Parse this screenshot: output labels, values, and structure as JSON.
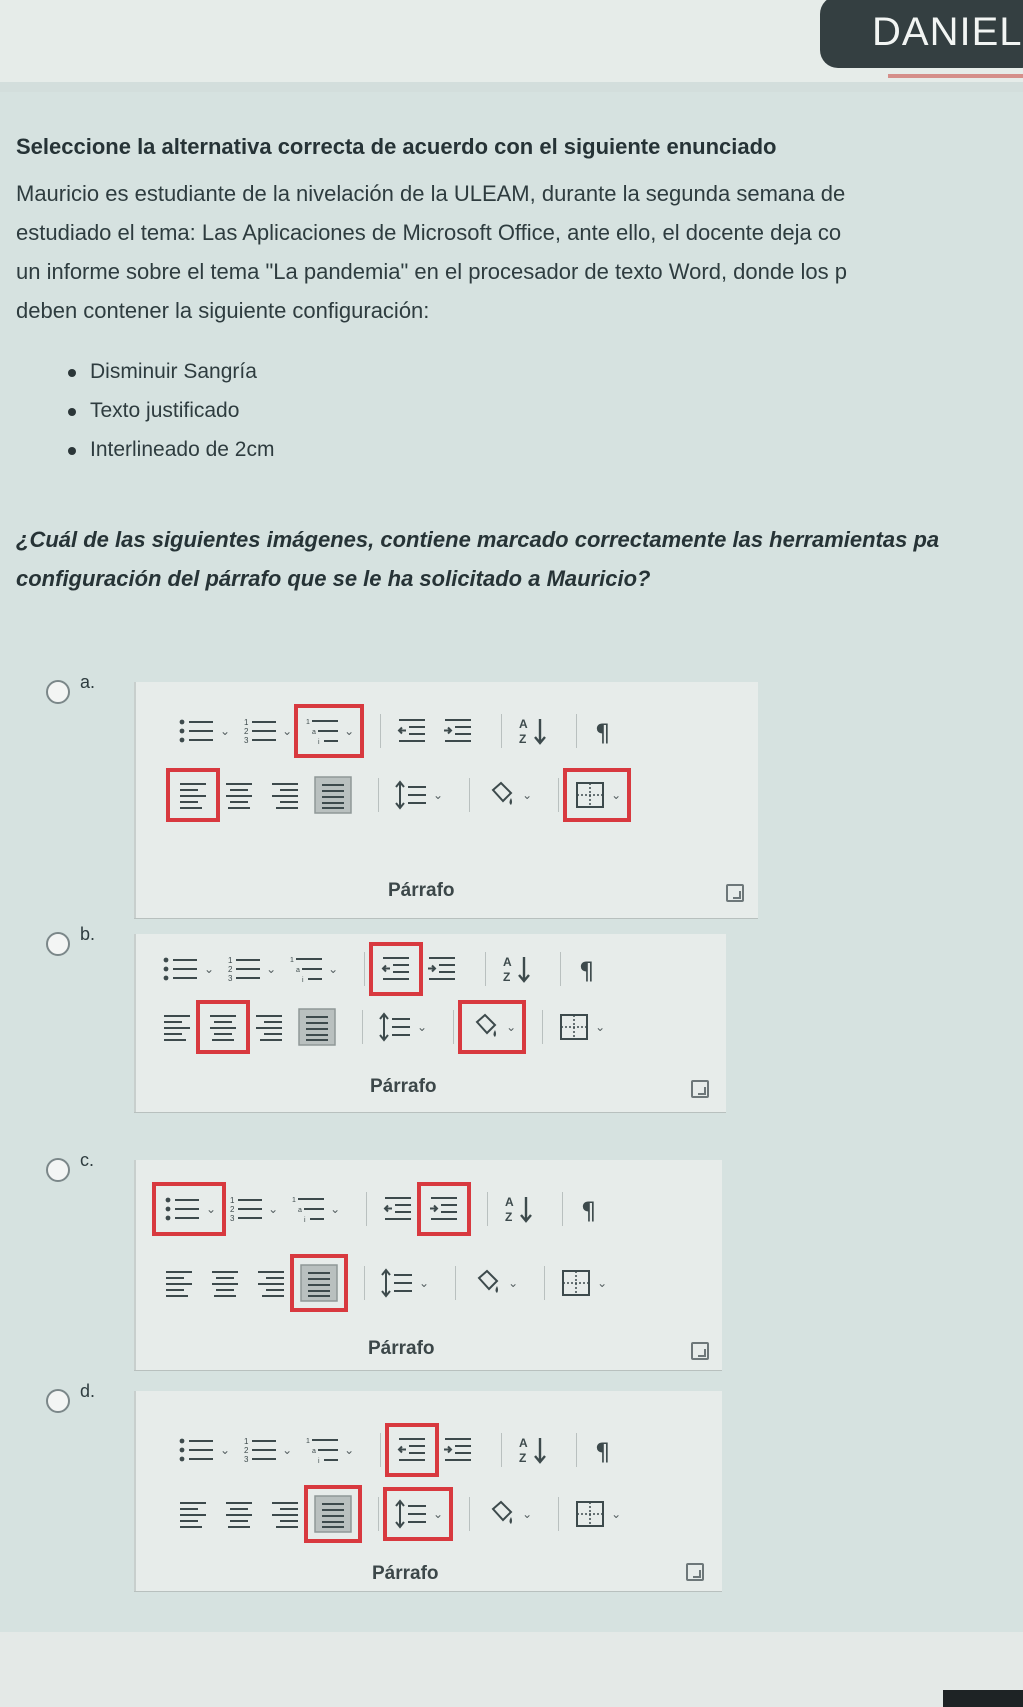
{
  "header": {
    "user_name": "DANIEL"
  },
  "heading": "Seleccione la alternativa correcta de acuerdo con el siguiente enunciado",
  "paragraph_lines": [
    "Mauricio es estudiante de la nivelación de la ULEAM, durante la segunda semana de",
    "estudiado el tema: Las Aplicaciones de Microsoft Office, ante ello, el docente deja co",
    "un informe sobre el tema \"La pandemia\" en el procesador de texto Word, donde los p",
    "deben contener la siguiente configuración:"
  ],
  "bullets": [
    "Disminuir Sangría",
    "Texto justificado",
    "Interlineado de 2cm"
  ],
  "question_lines": [
    "¿Cuál de las siguientes imágenes, contiene marcado correctamente las herramientas pa",
    "configuración del párrafo que se le ha solicitado a Mauricio?"
  ],
  "options": [
    {
      "letter": "a.",
      "group_label": "Párrafo",
      "highlighted": [
        "multilevel-list",
        "align-left",
        "borders"
      ]
    },
    {
      "letter": "b.",
      "group_label": "Párrafo",
      "highlighted": [
        "decrease-indent",
        "align-center",
        "shading"
      ]
    },
    {
      "letter": "c.",
      "group_label": "Párrafo",
      "highlighted": [
        "bullets",
        "increase-indent",
        "justify"
      ]
    },
    {
      "letter": "d.",
      "group_label": "Párrafo",
      "highlighted": [
        "decrease-indent",
        "justify",
        "line-spacing"
      ]
    }
  ],
  "colors": {
    "highlight": "#d8393f",
    "page_bg": "#d6e2e0",
    "panel_bg": "#e7ecea"
  }
}
